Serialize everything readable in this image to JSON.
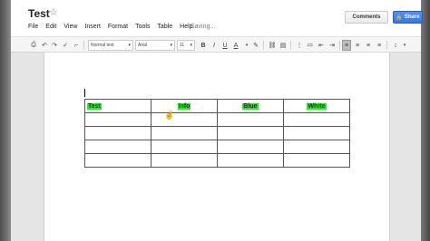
{
  "header": {
    "title": "Test",
    "menu": [
      "File",
      "Edit",
      "View",
      "Insert",
      "Format",
      "Tools",
      "Table",
      "Help"
    ],
    "status": "Saving...",
    "comments_label": "Comments",
    "share_label": "Share"
  },
  "toolbar": {
    "style_value": "Normal text",
    "font_value": "Arial",
    "size_value": "11",
    "bold": "B",
    "italic": "I",
    "underline": "U",
    "text_color": "A"
  },
  "table": {
    "header": [
      "Test",
      "Info",
      "Blue",
      "White"
    ],
    "empty_rows": 4,
    "highlight_color": "#22ee22"
  }
}
